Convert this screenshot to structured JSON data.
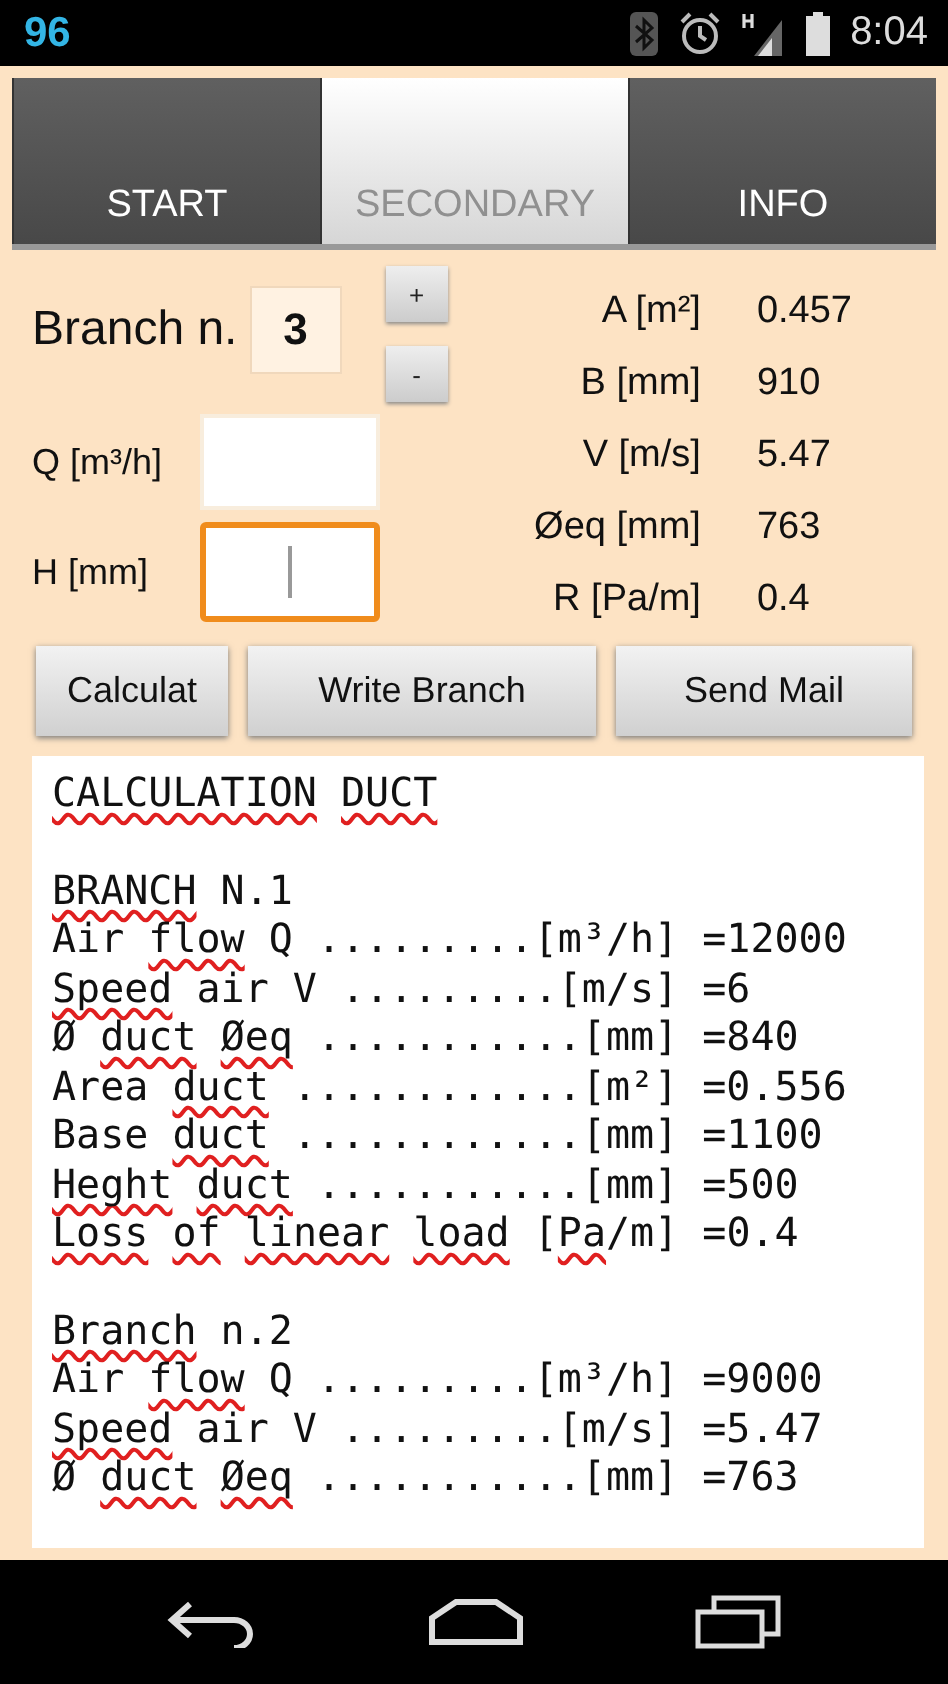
{
  "status_bar": {
    "notification": "96",
    "time": "8:04"
  },
  "tabs": [
    {
      "label": "START",
      "selected": false
    },
    {
      "label": "SECONDARY",
      "selected": true
    },
    {
      "label": "INFO",
      "selected": false
    }
  ],
  "branch": {
    "label": "Branch n.",
    "value": "3",
    "increment": "+",
    "decrement": "-"
  },
  "inputs": [
    {
      "label": "Q [m³/h]",
      "focused": false
    },
    {
      "label": "H [mm]",
      "focused": true
    }
  ],
  "results": [
    {
      "label": "A [m²]",
      "value": "0.457"
    },
    {
      "label": "B [mm]",
      "value": "910"
    },
    {
      "label": "V [m/s]",
      "value": "5.47"
    },
    {
      "label": "Øeq [mm]",
      "value": "763"
    },
    {
      "label": "R [Pa/m]",
      "value": "0.4"
    }
  ],
  "buttons": [
    "Calculat",
    "Write Branch",
    "Send Mail"
  ],
  "output": {
    "sections": [
      {
        "lines": [
          "*CALCULATION* *DUCT*"
        ]
      },
      {
        "lines": [
          "*BRANCH* N.1",
          "Air *flow* Q .........[m³/h] =12000",
          "*Speed* air V .........[m/s] =6",
          "Ø *duct* *Øeq* ...........[mm] =840",
          "Area *duct* ............[m²] =0.556",
          "Base *duct* ............[mm] =1100",
          "*Heght* *duct* ...........[mm] =500",
          "*Loss* *of* *linear* *load* [*Pa*/m] =0.4"
        ]
      },
      {
        "lines": [
          "*Branch* n.2",
          "Air *flow* Q .........[m³/h] =9000",
          "*Speed* air V .........[m/s] =5.47",
          "Ø *duct* *Øeq* ...........[mm] =763"
        ]
      }
    ]
  }
}
